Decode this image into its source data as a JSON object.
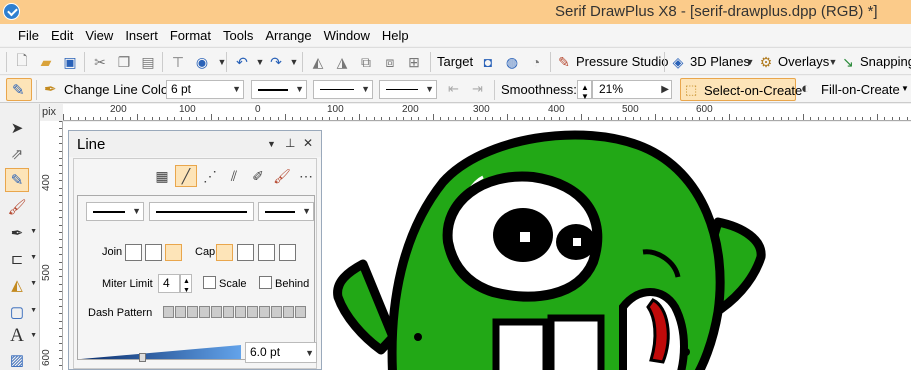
{
  "title_bar": {
    "title": "Serif DrawPlus X8 - [serif-drawplus.dpp (RGB) *]"
  },
  "menu": [
    "File",
    "Edit",
    "View",
    "Insert",
    "Format",
    "Tools",
    "Arrange",
    "Window",
    "Help"
  ],
  "toolbar": {
    "target_label": "Target",
    "pressure_label": "Pressure Studio",
    "planes_label": "3D Planes",
    "overlays_label": "Overlays",
    "snapping_label": "Snapping"
  },
  "context_toolbar": {
    "change_line_color": "Change Line Color",
    "line_width": "6 pt",
    "smoothness_label": "Smoothness:",
    "smoothness_value": "21%",
    "select_on_create": "Select-on-Create",
    "fill_on_create": "Fill-on-Create"
  },
  "ruler": {
    "unit": "pix",
    "h_labels": [
      "200",
      "100",
      "0",
      "100",
      "200",
      "300",
      "400",
      "500",
      "600"
    ],
    "v_labels": [
      "400",
      "500",
      "600"
    ]
  },
  "line_panel": {
    "title": "Line",
    "join_label": "Join",
    "cap_label": "Cap",
    "miter_label": "Miter Limit",
    "miter_value": "4",
    "scale_label": "Scale",
    "behind_label": "Behind",
    "dash_label": "Dash Pattern",
    "width_value": "6.0 pt",
    "width_fraction": 0.38
  },
  "colors": {
    "accent": "#fde4b8",
    "title_bar": "#fbcb8a",
    "monster_green": "#22a816",
    "tongue_red": "#c00a0a"
  }
}
